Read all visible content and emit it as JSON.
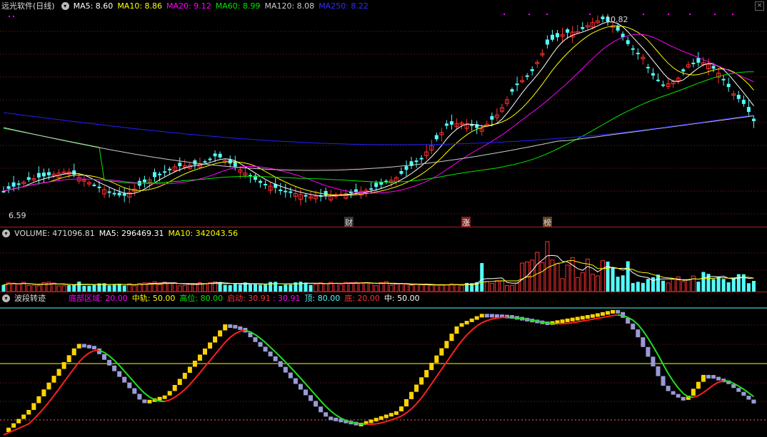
{
  "main_header": {
    "title": "远光软件(日线)",
    "ma5": "MA5: 8.60",
    "ma10": "MA10: 8.86",
    "ma20": "MA20: 9.12",
    "ma60": "MA60: 8.99",
    "ma120": "MA120: 8.08",
    "ma250": "MA250: 8.22"
  },
  "volume_header": {
    "volume": "VOLUME: 471096.81",
    "ma5": "MA5: 296469.31",
    "ma10": "MA10: 342043.56"
  },
  "indicator_header": {
    "name": "波段转迹",
    "bottom_zone": "底部区域: 20.00",
    "mid_track": "中轨: 50.00",
    "high_pos": "高位: 80.00",
    "start": "启动: 30.91",
    "start2": ": 30.91",
    "top": "顶: 80.00",
    "bottom": "底: 20.00",
    "middle": "中: 50.00"
  },
  "annotations": {
    "high_price": "10.82",
    "low_price": "6.59",
    "marker_cai": "财",
    "marker_zhang": "涨",
    "marker_bang": "榜"
  },
  "colors": {
    "up": "#ff3232",
    "down": "#54fcfc",
    "ma5": "#ffffff",
    "ma10": "#ffff00",
    "ma20": "#ff00ff",
    "ma60": "#00e600",
    "ma120": "#cccccc",
    "ma250": "#2020ff"
  }
}
